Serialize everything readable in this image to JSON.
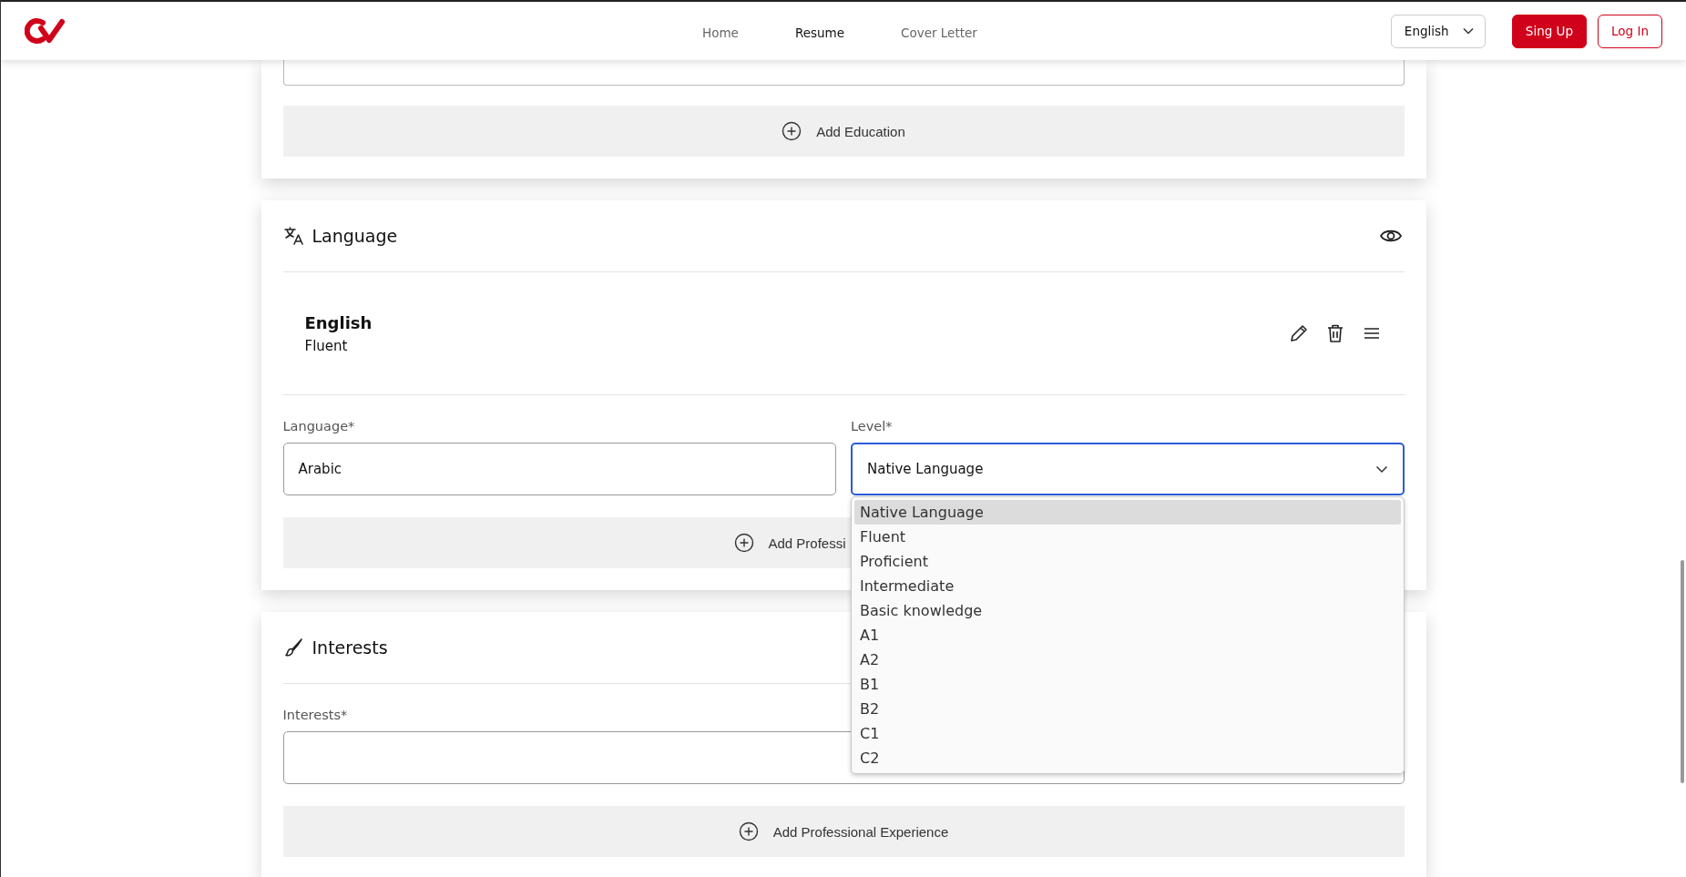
{
  "header": {
    "nav": [
      {
        "label": "Home",
        "selected": false
      },
      {
        "label": "Resume",
        "selected": true
      },
      {
        "label": "Cover Letter",
        "selected": false
      }
    ],
    "language_select": {
      "value": "English"
    },
    "buttons": [
      {
        "label": "Sing Up",
        "kind": "primary"
      },
      {
        "label": "Log In",
        "kind": "outline"
      }
    ]
  },
  "education": {
    "add_button": "Add Education"
  },
  "language": {
    "title": "Language",
    "entries": [
      {
        "name": "English",
        "proficiency": "Fluent"
      }
    ],
    "form": {
      "language_label": "Language*",
      "language_value": "Arabic",
      "level_label": "Level*",
      "level_value": "Native Language",
      "dropdown": {
        "expanded": true,
        "options": [
          {
            "label": "Native Language",
            "selected": true
          },
          {
            "label": "Fluent",
            "selected": false
          },
          {
            "label": "Proficient",
            "selected": false
          },
          {
            "label": "Intermediate",
            "selected": false
          },
          {
            "label": "Basic knowledge",
            "selected": false
          },
          {
            "label": "A1",
            "selected": false
          },
          {
            "label": "A2",
            "selected": false
          },
          {
            "label": "B1",
            "selected": false
          },
          {
            "label": "B2",
            "selected": false
          },
          {
            "label": "C1",
            "selected": false
          },
          {
            "label": "C2",
            "selected": false
          }
        ]
      }
    },
    "add_button": "Add Professi"
  },
  "interests": {
    "title": "Interests",
    "field_label": "Interests*",
    "add_button": "Add Professional Experience"
  }
}
